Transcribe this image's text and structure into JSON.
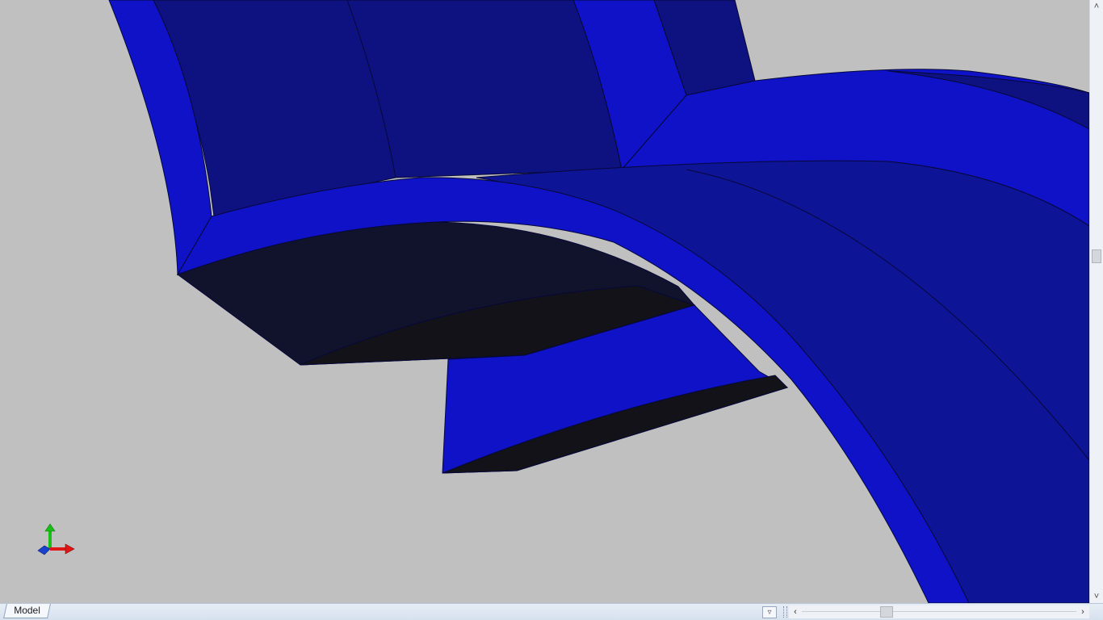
{
  "colors": {
    "background": "#c0c0c0",
    "face_bright": "#0f12c6",
    "face_medium": "#0e1496",
    "face_dark": "#0e1280",
    "face_shadow": "#11132c",
    "face_black": "#121218",
    "edge": "#060838",
    "axis_x": "#e01515",
    "axis_y": "#16c016",
    "axis_z": "#1c3fd0"
  },
  "viewport": {
    "model_name": "3d-part-geometry"
  },
  "tabs": [
    {
      "label": "Model",
      "active": true
    }
  ],
  "icons": {
    "tab_menu": "chevron-down-icon",
    "scroll_left": "chevron-left-icon",
    "scroll_right": "chevron-right-icon",
    "scroll_up": "chevron-up-icon",
    "scroll_down": "chevron-down-icon"
  },
  "glyphs": {
    "tab_menu": "▿",
    "left": "‹",
    "right": "›",
    "up": "˄",
    "down": "˅"
  }
}
